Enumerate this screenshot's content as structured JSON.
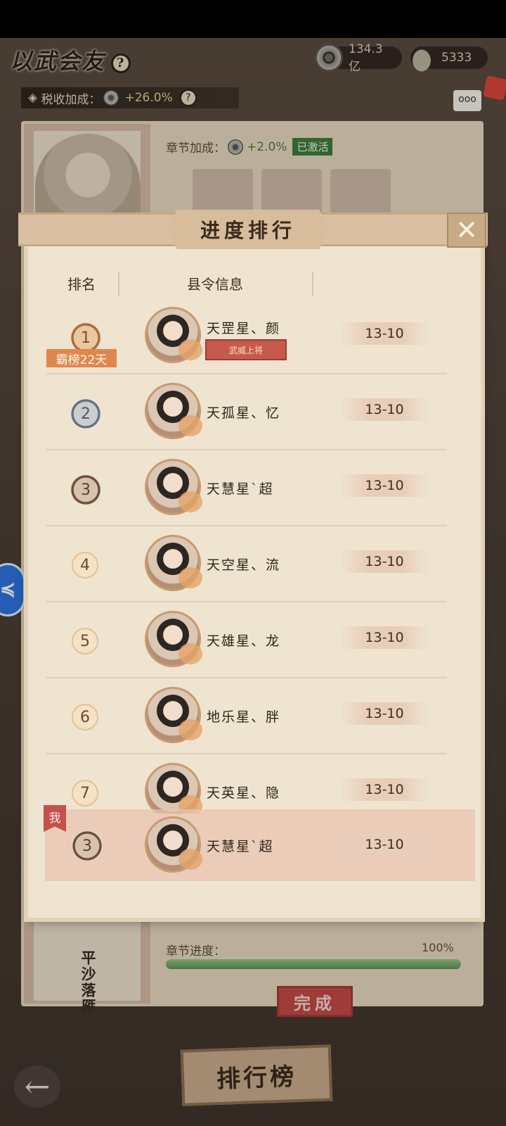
{
  "header": {
    "title": "以武会友",
    "help": "?",
    "coins": "134.3亿",
    "ingots": "5333",
    "tax_label": "税收加成：",
    "tax_value": "+26.0%",
    "chat": "ooo"
  },
  "chapter": {
    "bonus_label": "章节加成：",
    "bonus_value": "+2.0%",
    "bonus_status": "已激活",
    "stage_name": "平沙落雁",
    "progress_label": "章节进度：",
    "progress_value": "100%",
    "progress_fraction": 1.0,
    "done_button": "完成"
  },
  "modal": {
    "title": "进度排行",
    "close": "✕",
    "col_rank": "排名",
    "col_info": "县令信息",
    "rows": [
      {
        "rank": "1",
        "name": "天罡星、颜",
        "score": "13-10",
        "days": "霸榜22天",
        "title": "武威上将"
      },
      {
        "rank": "2",
        "name": "天孤星、忆",
        "score": "13-10"
      },
      {
        "rank": "3",
        "name": "天慧星`超",
        "score": "13-10"
      },
      {
        "rank": "4",
        "name": "天空星、流",
        "score": "13-10"
      },
      {
        "rank": "5",
        "name": "天雄星、龙",
        "score": "13-10"
      },
      {
        "rank": "6",
        "name": "地乐星、胖",
        "score": "13-10"
      },
      {
        "rank": "7",
        "name": "天英星、隐",
        "score": "13-10"
      }
    ],
    "me": {
      "flag": "我",
      "rank": "3",
      "name": "天慧星`超",
      "score": "13-10"
    }
  },
  "footer": {
    "rank_button": "排行榜",
    "back": "←"
  },
  "colors": {
    "accent_red": "#c24a45",
    "progress_green": "#5c9150",
    "days_tag": "#e0874f"
  }
}
